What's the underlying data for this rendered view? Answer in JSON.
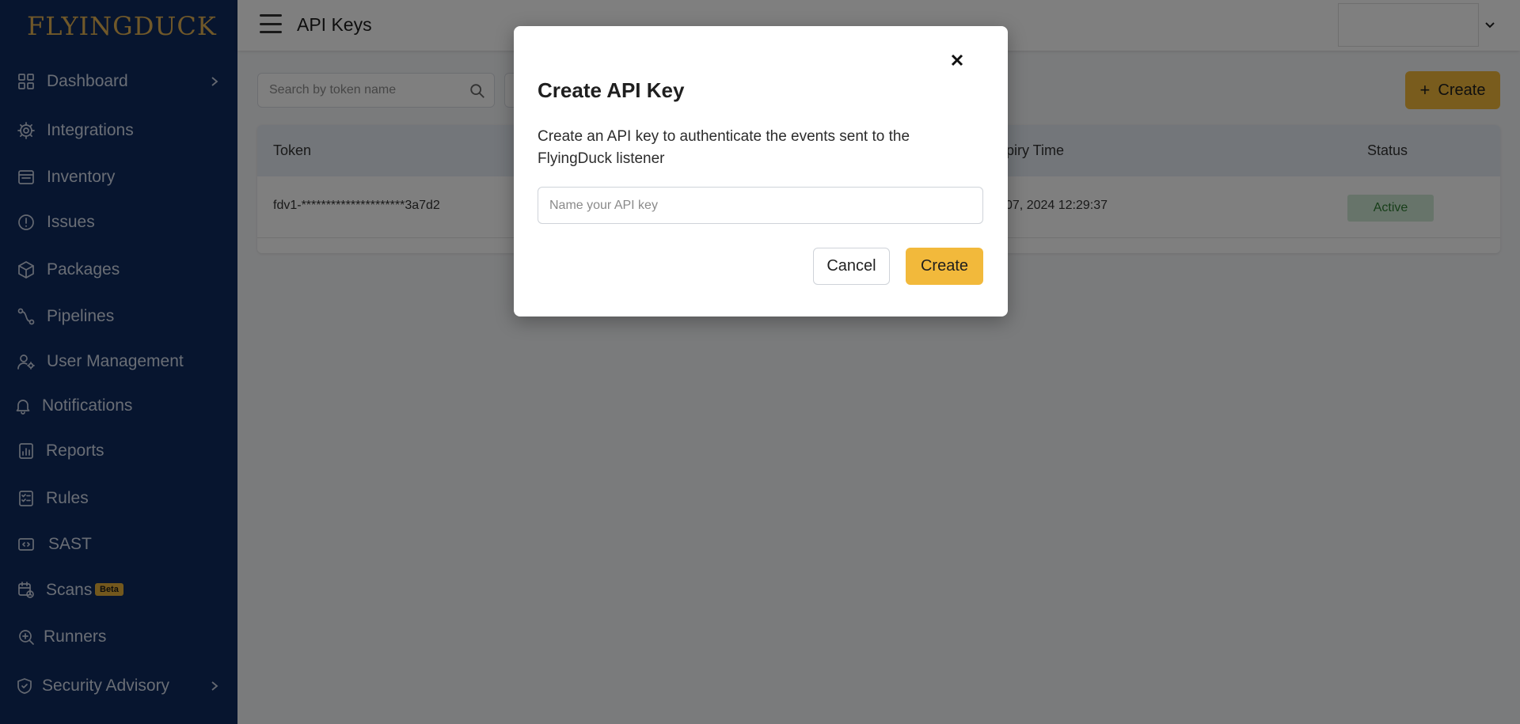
{
  "app": {
    "logo_text": "FLYINGDUCK",
    "brand_color": "#e0b052",
    "accent_color": "#f2b93b"
  },
  "sidebar": {
    "items": [
      {
        "label": "Dashboard",
        "icon": "dashboard-grid-icon",
        "has_chevron": true
      },
      {
        "label": "Integrations",
        "icon": "gear-icon"
      },
      {
        "label": "Inventory",
        "icon": "inventory-icon"
      },
      {
        "label": "Issues",
        "icon": "alert-circle-icon"
      },
      {
        "label": "Packages",
        "icon": "package-box-icon"
      },
      {
        "label": "Pipelines",
        "icon": "pipeline-icon"
      },
      {
        "label": "User Management",
        "icon": "user-settings-icon"
      },
      {
        "label": "Notifications",
        "icon": "bell-icon"
      },
      {
        "label": "Reports",
        "icon": "report-icon"
      },
      {
        "label": "Rules",
        "icon": "rules-checklist-icon"
      },
      {
        "label": "SAST",
        "icon": "code-icon"
      },
      {
        "label": "Scans",
        "icon": "calendar-clock-icon",
        "badge": "Beta"
      },
      {
        "label": "Runners",
        "icon": "runner-search-icon"
      },
      {
        "label": "Security Advisory",
        "icon": "shield-icon",
        "has_chevron": true
      }
    ]
  },
  "header": {
    "title": "API Keys"
  },
  "search": {
    "placeholder": "Search by token name"
  },
  "toolbar": {
    "create_label": "Create",
    "create_icon": "+"
  },
  "table": {
    "columns": [
      "Token",
      "Expiry Time",
      "Status"
    ],
    "rows": [
      {
        "token": "fdv1-*********************3a7d2",
        "expiry": "07, 2024 12:29:37",
        "status": "Active"
      }
    ]
  },
  "modal": {
    "title": "Create API Key",
    "description": "Create an API key to authenticate the events sent to the FlyingDuck listener",
    "input_placeholder": "Name your API key",
    "input_value": "",
    "cancel_label": "Cancel",
    "create_label": "Create"
  }
}
